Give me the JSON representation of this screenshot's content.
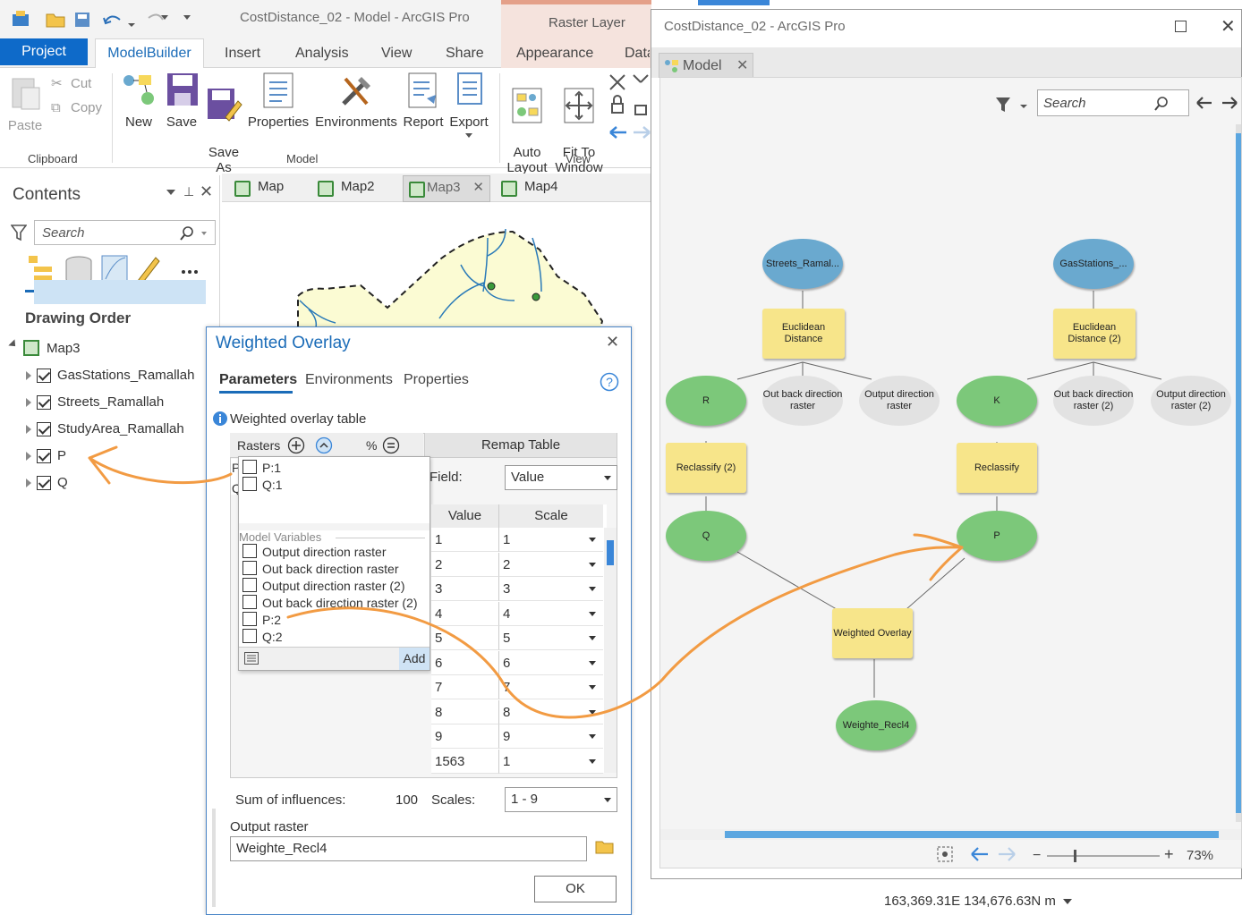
{
  "app": {
    "title": "CostDistance_02 - Model - ArcGIS Pro",
    "context_tab": "Raster Layer"
  },
  "ribbon": {
    "tabs": [
      "Project",
      "ModelBuilder",
      "Insert",
      "Analysis",
      "View",
      "Share",
      "Appearance",
      "Data"
    ],
    "clipboard": {
      "paste": "Paste",
      "cut": "Cut",
      "copy": "Copy",
      "group": "Clipboard"
    },
    "model": {
      "new": "New",
      "save": "Save",
      "save_as": "Save\nAs",
      "properties": "Properties",
      "environments": "Environments",
      "report": "Report",
      "export": "Export",
      "group": "Model"
    },
    "view": {
      "auto_layout": "Auto\nLayout",
      "fit_to_window": "Fit To\nWindow",
      "group": "View"
    }
  },
  "map_tabs": [
    "Map",
    "Map2",
    "Map3",
    "Map4"
  ],
  "contents": {
    "title": "Contents",
    "search_placeholder": "Search",
    "drawing_order": "Drawing Order",
    "map_name": "Map3",
    "layers": [
      {
        "name": "GasStations_Ramallah",
        "checked": true
      },
      {
        "name": "Streets_Ramallah",
        "checked": true
      },
      {
        "name": "StudyArea_Ramallah",
        "checked": true
      },
      {
        "name": "P",
        "checked": true,
        "selected": true
      },
      {
        "name": "Q",
        "checked": true
      }
    ]
  },
  "dialog": {
    "title": "Weighted Overlay",
    "tabs": [
      "Parameters",
      "Environments",
      "Properties"
    ],
    "table_label": "Weighted overlay table",
    "rasters_header": "Rasters",
    "percent_header": "%",
    "remap_header": "Remap Table",
    "field_label": "Field:",
    "field_value": "Value",
    "value_header": "Value",
    "scale_header": "Scale",
    "remap_rows": [
      {
        "value": "1",
        "scale": "1"
      },
      {
        "value": "2",
        "scale": "2"
      },
      {
        "value": "3",
        "scale": "3"
      },
      {
        "value": "4",
        "scale": "4"
      },
      {
        "value": "5",
        "scale": "5"
      },
      {
        "value": "6",
        "scale": "6"
      },
      {
        "value": "7",
        "scale": "7"
      },
      {
        "value": "8",
        "scale": "8"
      },
      {
        "value": "9",
        "scale": "9"
      },
      {
        "value": "1563",
        "scale": "1"
      }
    ],
    "popup_layers": [
      "P:1",
      "Q:1"
    ],
    "model_variables_label": "Model Variables",
    "model_variables": [
      "Output direction raster",
      "Out back direction raster",
      "Output direction raster (2)",
      "Out back direction raster (2)",
      "P:2",
      "Q:2"
    ],
    "add_button": "Add",
    "sum_label": "Sum of influences:",
    "sum_value": "100",
    "scales_label": "Scales:",
    "scales_value": "1 - 9",
    "output_label": "Output raster",
    "output_value": "Weighte_Recl4",
    "ok_button": "OK",
    "row_stub_p": "P",
    "row_stub_q": "Q"
  },
  "model_window": {
    "title": "CostDistance_02 - ArcGIS Pro",
    "tab": "Model",
    "search_placeholder": "Search",
    "zoom": "73%",
    "nodes": {
      "streets": "Streets_Ramal...",
      "gas": "GasStations_...",
      "ed1": "Euclidean Distance",
      "ed2": "Euclidean Distance (2)",
      "r": "R",
      "obdr1": "Out back direction raster",
      "odr1": "Output direction raster",
      "k": "K",
      "obdr2": "Out back direction raster (2)",
      "odr2": "Output direction raster (2)",
      "reclass2": "Reclassify (2)",
      "reclass": "Reclassify",
      "q": "Q",
      "p": "P",
      "wo": "Weighted Overlay",
      "out": "Weighte_Recl4"
    }
  },
  "status": {
    "coordinates": "163,369.31E 134,676.63N m"
  }
}
